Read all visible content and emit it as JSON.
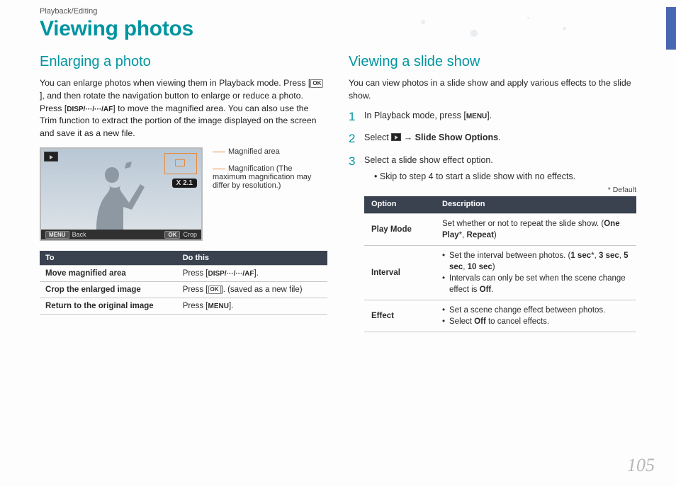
{
  "breadcrumb": "Playback/Editing",
  "title": "Viewing photos",
  "pageNumber": "105",
  "left": {
    "heading": "Enlarging a photo",
    "paraPrefix": "You can enlarge photos when viewing them in Playback mode. Press [",
    "ok": "OK",
    "paraMid1": "], and then rotate the navigation button to enlarge or reduce a photo. Press [",
    "navKeys": "DISP/···/···/AF",
    "paraSuffix": "] to move the magnified area. You can also use the Trim function to extract the portion of the image displayed on the screen and save it as a new file.",
    "viewer": {
      "zoom": "X 2.1",
      "menu": "MENU",
      "back": "Back",
      "okLabel": "OK",
      "crop": "Crop"
    },
    "annot": {
      "a1": "Magnified area",
      "a2": "Magnification (The maximum magnification may differ by resolution.)"
    },
    "table": {
      "h1": "To",
      "h2": "Do this",
      "r1c1": "Move magnified area",
      "r1c2a": "Press [",
      "r1c2key": "DISP/···/···/AF",
      "r1c2b": "].",
      "r2c1": "Crop the enlarged image",
      "r2c2a": "Press [",
      "r2c2key": "OK",
      "r2c2b": "]. (saved as a new file)",
      "r3c1": "Return to the original image",
      "r3c2a": "Press [",
      "r3c2key": "MENU",
      "r3c2b": "]."
    }
  },
  "right": {
    "heading": "Viewing a slide show",
    "para": "You can view photos in a slide show and apply various effects to the slide show.",
    "step1a": "In Playback mode, press [",
    "step1key": "MENU",
    "step1b": "].",
    "step2a": "Select ",
    "step2b": " → ",
    "step2bold": "Slide Show Options",
    "step2c": ".",
    "step3": "Select a slide show effect option.",
    "step3sub": "Skip to step 4 to start a slide show with no effects.",
    "defaultNote": "* Default",
    "table": {
      "h1": "Option",
      "h2": "Description",
      "r1c1": "Play Mode",
      "r1c2a": "Set whether or not to repeat the slide show. (",
      "r1c2b1": "One Play",
      "r1c2star1": "*, ",
      "r1c2b2": "Repeat",
      "r1c2c": ")",
      "r2c1": "Interval",
      "r2l1a": "Set the interval between photos. (",
      "r2l1_1": "1 sec",
      "r2l1_star": "*, ",
      "r2l1_2": "3 sec",
      "r2l1_c": ", ",
      "r2l1_3": "5 sec",
      "r2l1_c2": ", ",
      "r2l1_4": "10 sec",
      "r2l1_end": ")",
      "r2l2a": "Intervals can only be set when the scene change effect is ",
      "r2l2b": "Off",
      "r2l2c": ".",
      "r3c1": "Effect",
      "r3l1": "Set a scene change effect between photos.",
      "r3l2a": "Select ",
      "r3l2b": "Off",
      "r3l2c": " to cancel effects."
    }
  }
}
